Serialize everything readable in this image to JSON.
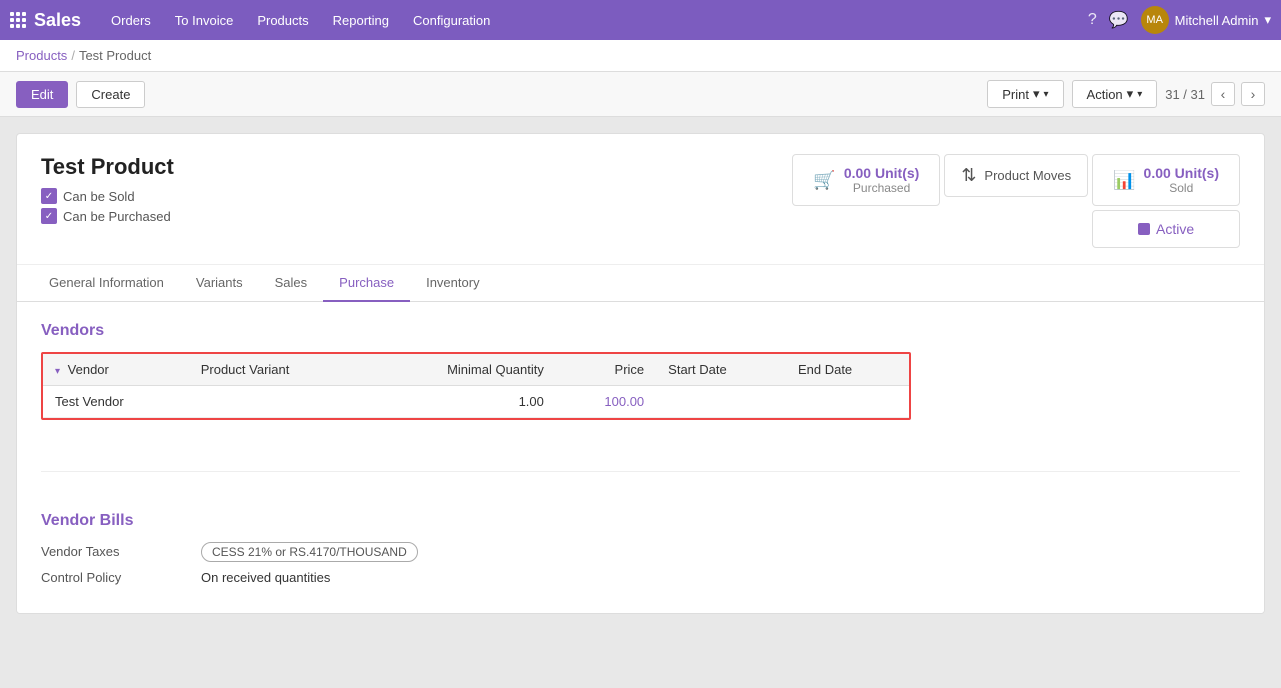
{
  "navbar": {
    "brand": "Sales",
    "nav_items": [
      "Orders",
      "To Invoice",
      "Products",
      "Reporting",
      "Configuration"
    ],
    "user": "Mitchell Admin"
  },
  "breadcrumb": {
    "parent": "Products",
    "current": "Test Product",
    "separator": "/"
  },
  "toolbar": {
    "edit_label": "Edit",
    "create_label": "Create",
    "print_label": "Print",
    "action_label": "Action",
    "pagination": "31 / 31"
  },
  "product": {
    "title": "Test Product",
    "can_be_sold_label": "Can be Sold",
    "can_be_purchased_label": "Can be Purchased",
    "stats": {
      "purchased_amount": "0.00 Unit(s)",
      "purchased_label": "Purchased",
      "sold_amount": "0.00 Unit(s)",
      "sold_label": "Sold",
      "product_moves_label": "Product Moves",
      "active_label": "Active"
    }
  },
  "tabs": [
    {
      "id": "general",
      "label": "General Information"
    },
    {
      "id": "variants",
      "label": "Variants"
    },
    {
      "id": "sales",
      "label": "Sales"
    },
    {
      "id": "purchase",
      "label": "Purchase",
      "active": true
    },
    {
      "id": "inventory",
      "label": "Inventory"
    }
  ],
  "vendors_section": {
    "title": "Vendors",
    "table": {
      "columns": [
        "Vendor",
        "Product Variant",
        "Minimal Quantity",
        "Price",
        "Start Date",
        "End Date"
      ],
      "rows": [
        {
          "vendor": "Test Vendor",
          "product_variant": "",
          "minimal_quantity": "1.00",
          "price": "100.00",
          "start_date": "",
          "end_date": ""
        }
      ]
    }
  },
  "vendor_bills_section": {
    "title": "Vendor Bills",
    "fields": [
      {
        "label": "Vendor Taxes",
        "value": "CESS 21% or RS.4170/THOUSAND",
        "is_tag": true
      },
      {
        "label": "Control Policy",
        "value": "On received quantities"
      }
    ]
  }
}
